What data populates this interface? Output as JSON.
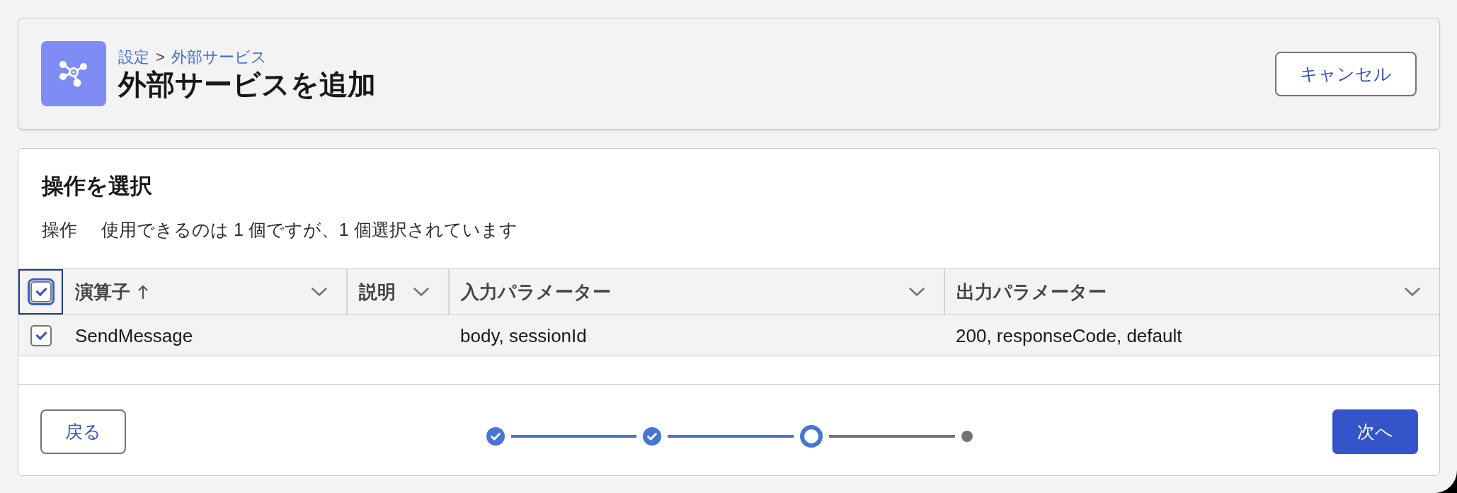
{
  "header": {
    "breadcrumb": {
      "items": [
        "設定",
        "外部サービス"
      ],
      "separator": ">"
    },
    "title": "外部サービスを追加",
    "cancel_button": "キャンセル"
  },
  "operations": {
    "title": "操作を選択",
    "label": "操作",
    "summary": "使用できるのは 1 個ですが、1 個選択されています",
    "table": {
      "select_all": {
        "checked": true,
        "focused": true
      },
      "columns": [
        {
          "label": "演算子",
          "sorted": true
        },
        {
          "label": "説明",
          "sorted": false
        },
        {
          "label": "入力パラメーター",
          "sorted": false
        },
        {
          "label": "出力パラメーター",
          "sorted": false
        }
      ],
      "rows": [
        {
          "selected": true,
          "cells": [
            "SendMessage",
            null,
            "body, sessionId",
            "200, responseCode, default"
          ]
        }
      ]
    }
  },
  "footer": {
    "back_button": "戻る",
    "progress": {
      "steps": [
        {
          "completed": true,
          "current": false
        },
        {
          "completed": true,
          "current": false
        },
        {
          "completed": false,
          "current": true
        },
        {
          "completed": false,
          "current": false
        }
      ]
    },
    "next_button": "次へ"
  }
}
